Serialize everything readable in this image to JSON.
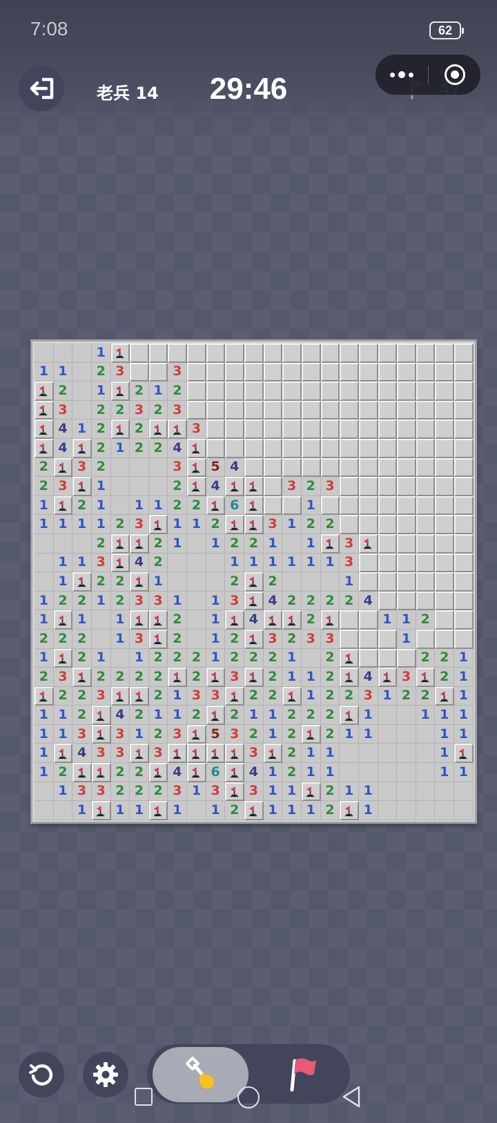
{
  "status_bar": {
    "time": "7:08",
    "battery": "62"
  },
  "header": {
    "level": "老兵 14",
    "timer": "29:46",
    "flags_remaining": "47",
    "icons": {
      "exit": "exit-icon",
      "more": "more-dots-icon",
      "close": "mini-program-close-icon",
      "flag": "flag-icon"
    }
  },
  "board": {
    "columns": 23,
    "rows": 25,
    "legend": {
      "H": "hidden",
      "F": "flagged",
      "0": "revealed-empty",
      "1-8": "revealed-number"
    },
    "cells": [
      "0 0 0 1 F H H H H H H H H H H H H H H H H H H",
      "1 1 0 2 3 H H 3 H H H H H H H H H H H H H H H",
      "F 2 0 1 F 2 1 2 H H H H H H H H H H H H H H H",
      "F 3 0 2 2 3 2 3 H H H H H H H H H H H H H H H",
      "F 4 1 2 F 2 F F 3 H H H H H H H H H H H H H H",
      "F 4 F 2 1 2 2 4 F H H H H H H H H H H H H H H",
      "2 F 3 2 0 0 0 3 F 5 4 H H H H H H H H H H H H",
      "2 3 F 1 0 0 0 2 F 4 F F H 3 2 3 H H H H H H H",
      "1 F 2 1 0 1 1 2 2 F 6 F H H 1 H H H H H H H H",
      "1 1 1 1 2 3 F 1 1 2 F F 3 1 2 2 H H H H H H H",
      "0 0 0 2 F F 2 1 0 1 2 2 1 0 1 F 3 F H H H H H",
      "0 1 1 3 F 4 2 0 0 0 1 1 1 1 1 1 3 H H H H H H",
      "0 1 F 2 2 F 1 0 0 0 2 F 2 0 0 0 1 H H H H H H",
      "1 2 2 1 2 3 3 1 0 1 3 F 4 2 2 2 2 4 H H H H H",
      "1 F 1 0 1 F F 2 0 1 F 4 F F 2 F H H 1 1 2 H H",
      "2 2 2 0 1 3 F 2 0 1 2 F 3 2 3 3 H H H 1 H H H",
      "1 F 2 1 0 1 2 2 2 1 2 2 2 1 0 2 F H H H 2 2 1",
      "2 3 F 2 2 2 2 F 2 F 3 F 2 1 1 2 F 4 F 3 F 2 1",
      "F 2 2 3 F F 2 1 3 3 F 2 2 F 1 2 2 3 1 2 2 F 1",
      "1 1 2 F 4 2 1 1 2 F 2 1 1 2 2 2 F 1 0 0 1 1 1",
      "1 1 3 F 3 1 2 3 F 5 3 2 1 2 F 2 1 1 0 0 0 1 1",
      "1 F 4 3 3 F 3 F F F F 3 F 2 1 1 0 0 0 0 0 1 F",
      "1 2 F F 2 2 F 4 F 6 F 4 1 2 1 1 0 0 0 0 0 1 1",
      "0 1 3 3 2 2 2 3 1 3 F 3 1 1 F 2 1 1 0 0 0 0 0",
      "0 0 1 F 1 1 F 1 0 1 2 F 1 1 1 2 F 1 0 0 0 0 0"
    ]
  },
  "toolbar": {
    "icons": {
      "restart": "restart-icon",
      "settings": "gear-icon",
      "dig": "shovel-icon",
      "flag": "flag-mode-icon"
    },
    "active_tool": "dig"
  },
  "nav_bar": {
    "icons": [
      "recent-apps-icon",
      "home-icon",
      "back-icon"
    ]
  },
  "colors": {
    "background": "#54586b",
    "board": "#d4d4d4",
    "number_1": "#2f55c6",
    "number_2": "#2f8a3a",
    "number_3": "#d23b3b",
    "number_4": "#353d8a",
    "number_5": "#8a1e1e",
    "number_6": "#1f8a8a",
    "flag": "#e6324b"
  }
}
